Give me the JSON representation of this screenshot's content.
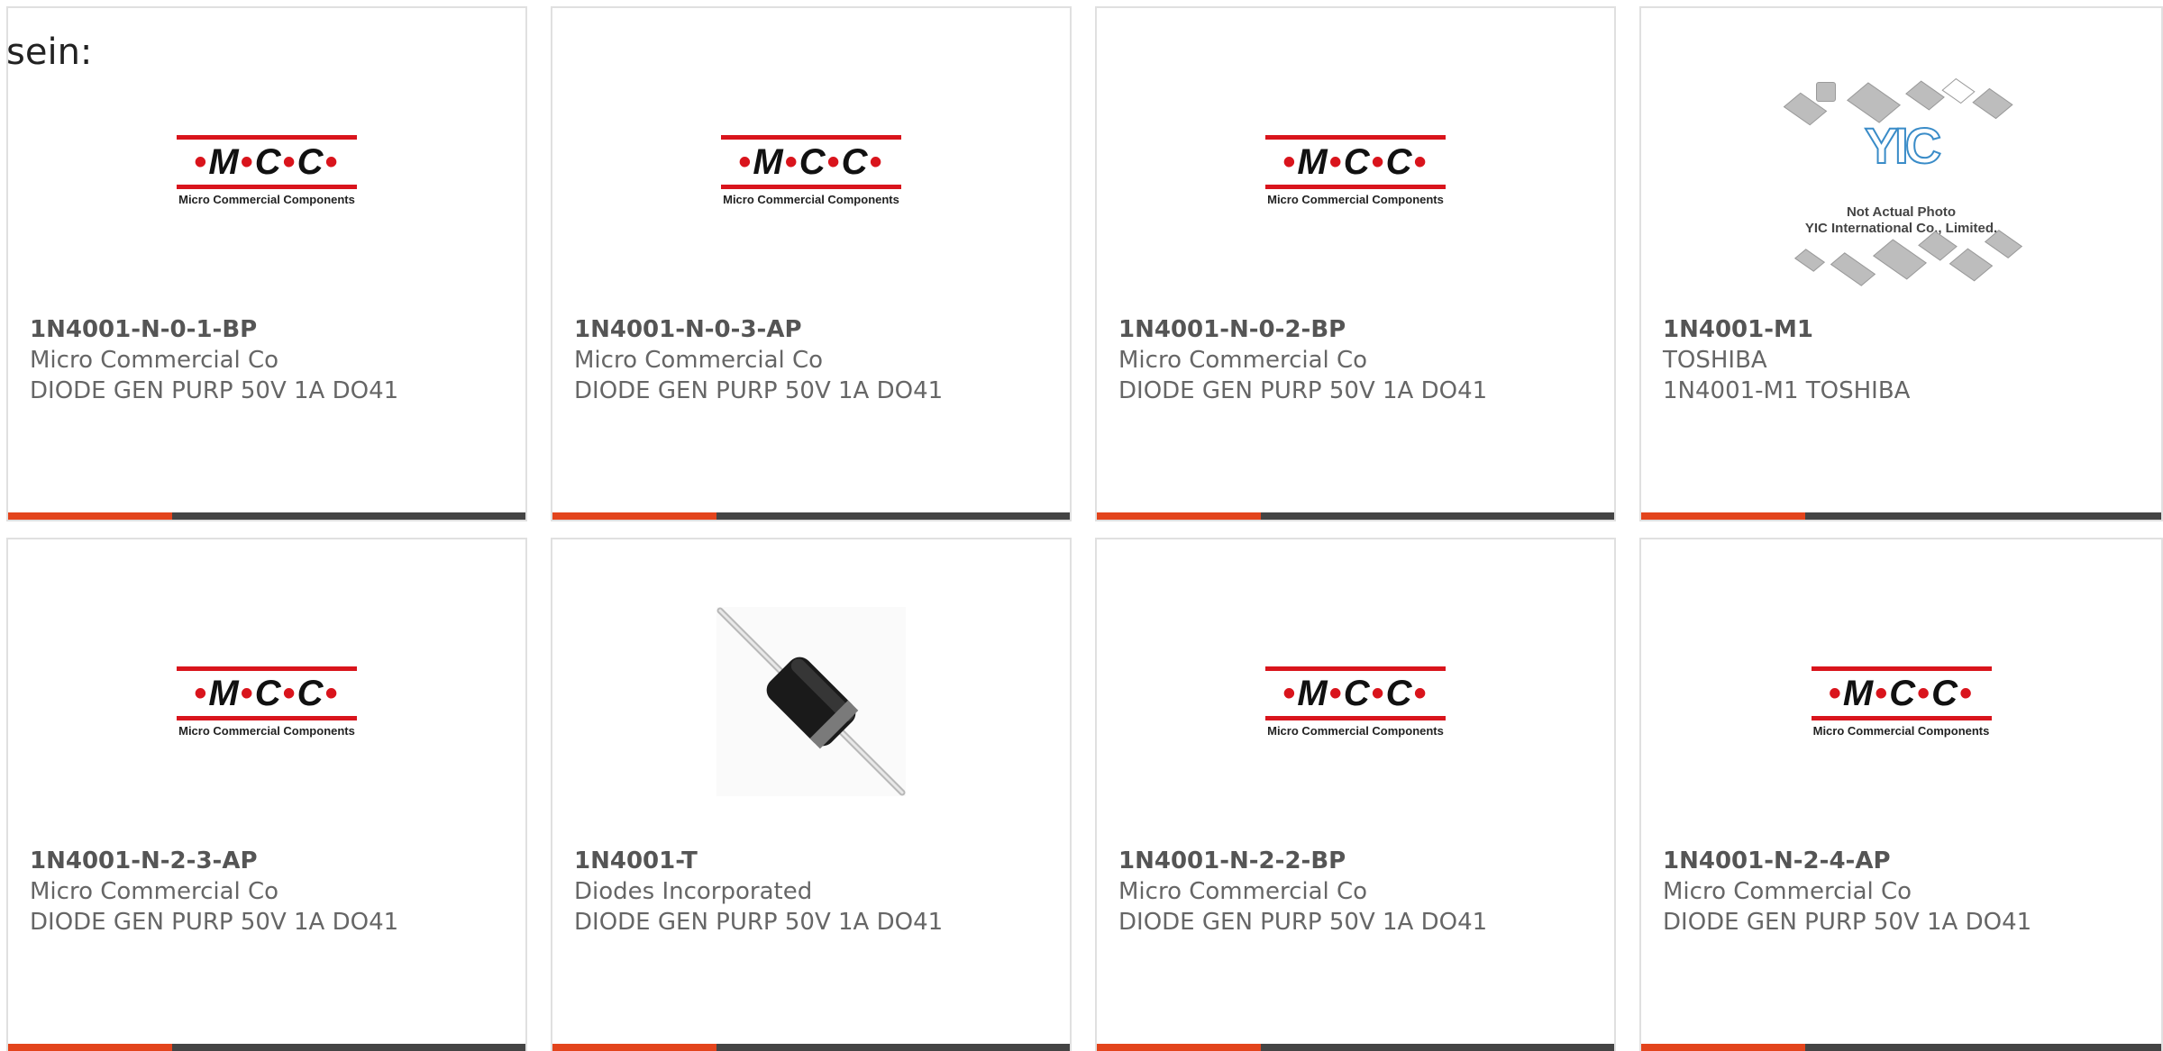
{
  "leading_text": "sein:",
  "colors": {
    "accent": "#e3441c",
    "bar": "#444444",
    "mcc_red": "#d9141c",
    "yic_blue": "#3a8cc8"
  },
  "logos": {
    "mcc": {
      "mark": "M·C·C",
      "tagline": "Micro Commercial Components"
    },
    "yic": {
      "mark": "YIC",
      "caption_line1": "Not Actual Photo",
      "caption_line2": "YIC International Co., Limited."
    }
  },
  "products": [
    {
      "part_number": "1N4001-N-0-1-BP",
      "manufacturer": "Micro Commercial Co",
      "description": "DIODE GEN PURP 50V 1A DO41",
      "image": "mcc-logo"
    },
    {
      "part_number": "1N4001-N-0-3-AP",
      "manufacturer": "Micro Commercial Co",
      "description": "DIODE GEN PURP 50V 1A DO41",
      "image": "mcc-logo"
    },
    {
      "part_number": "1N4001-N-0-2-BP",
      "manufacturer": "Micro Commercial Co",
      "description": "DIODE GEN PURP 50V 1A DO41",
      "image": "mcc-logo"
    },
    {
      "part_number": "1N4001-M1",
      "manufacturer": "TOSHIBA",
      "description": "1N4001-M1 TOSHIBA",
      "image": "yic-placeholder"
    },
    {
      "part_number": "1N4001-N-2-3-AP",
      "manufacturer": "Micro Commercial Co",
      "description": "DIODE GEN PURP 50V 1A DO41",
      "image": "mcc-logo"
    },
    {
      "part_number": "1N4001-T",
      "manufacturer": "Diodes Incorporated",
      "description": "DIODE GEN PURP 50V 1A DO41",
      "image": "diode-photo"
    },
    {
      "part_number": "1N4001-N-2-2-BP",
      "manufacturer": "Micro Commercial Co",
      "description": "DIODE GEN PURP 50V 1A DO41",
      "image": "mcc-logo"
    },
    {
      "part_number": "1N4001-N-2-4-AP",
      "manufacturer": "Micro Commercial Co",
      "description": "DIODE GEN PURP 50V 1A DO41",
      "image": "mcc-logo"
    }
  ]
}
